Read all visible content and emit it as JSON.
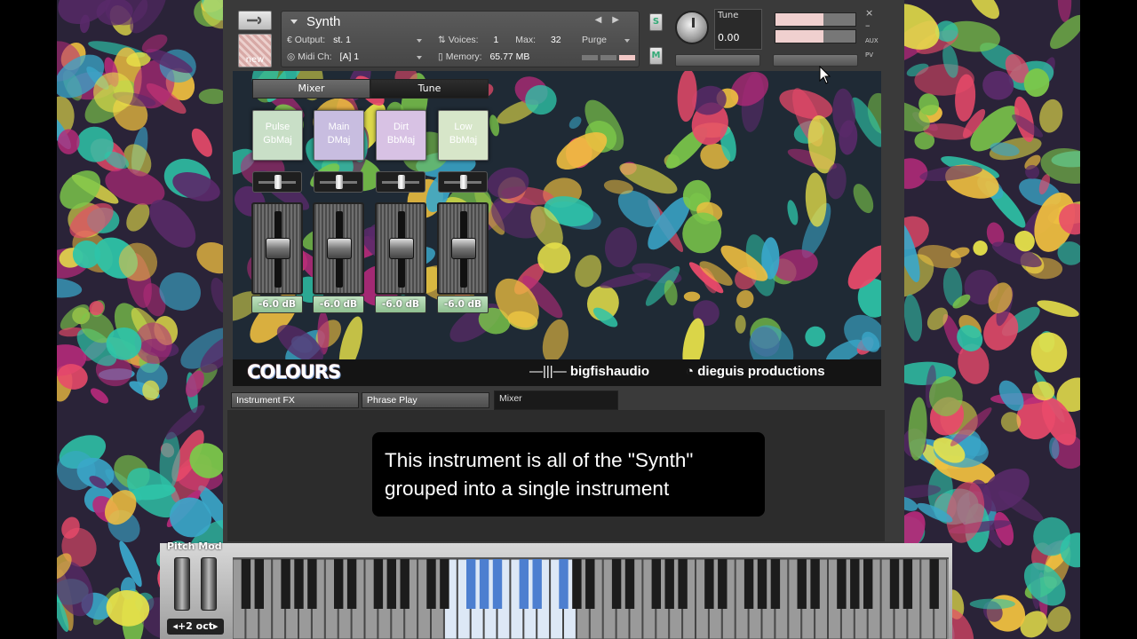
{
  "header": {
    "instrument_name": "Synth",
    "new_label": "new",
    "output_label": "Output:",
    "output_value": "st. 1",
    "voices_label": "Voices:",
    "voices_value": "1",
    "max_label": "Max:",
    "max_value": "32",
    "purge_label": "Purge",
    "midi_label": "Midi Ch:",
    "midi_value": "[A] 1",
    "memory_label": "Memory:",
    "memory_value": "65.77 MB",
    "solo_label": "S",
    "mute_label": "M",
    "tune_label": "Tune",
    "tune_value": "0.00",
    "side_labels": [
      "AUX",
      "PV"
    ]
  },
  "tabs": {
    "mixer": "Mixer",
    "tune": "Tune"
  },
  "channels": [
    {
      "line1": "Pulse",
      "line2": "GbMaj",
      "db": "-6.0 dB",
      "color": "#c9dfc7"
    },
    {
      "line1": "Main",
      "line2": "DMaj",
      "db": "-6.0 dB",
      "color": "#c8bde0"
    },
    {
      "line1": "Dirt",
      "line2": "BbMaj",
      "db": "-6.0 dB",
      "color": "#d8c2e4"
    },
    {
      "line1": "Low",
      "line2": "BbMaj",
      "db": "-6.0 dB",
      "color": "#d7e6c9"
    }
  ],
  "branding": {
    "colours": "COLOURS",
    "bigfish": "bigfishaudio",
    "dieguis": "dieguis productions"
  },
  "bottom_tabs": [
    "Instrument FX",
    "Phrase Play",
    "Mixer"
  ],
  "caption": {
    "line1": "This instrument is all of the \"Synth\"",
    "line2": "grouped into a single instrument"
  },
  "keyboard": {
    "pitch_label": "Pitch Mod",
    "octave_label": "+2 oct",
    "highlight_color": "#4d7fd0"
  }
}
